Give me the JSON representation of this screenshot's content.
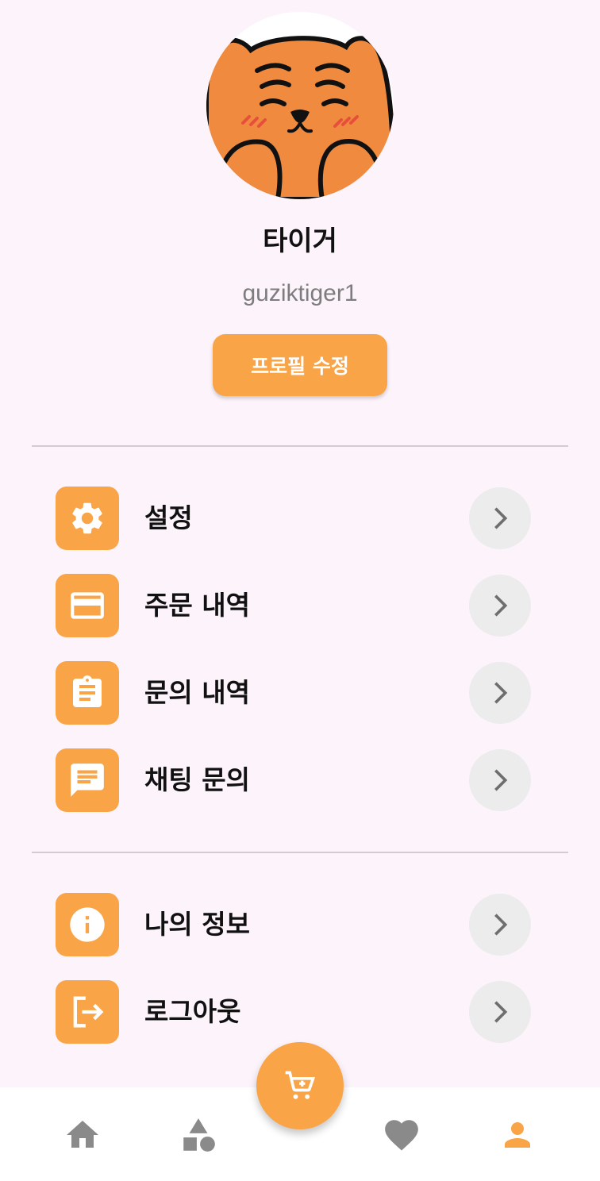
{
  "profile": {
    "avatar_icon": "tiger-avatar",
    "name": "타이거",
    "username": "guziktiger1",
    "edit_button_label": "프로필 수정"
  },
  "menu_group_1": [
    {
      "label": "설정",
      "icon": "gear-icon"
    },
    {
      "label": "주문 내역",
      "icon": "credit-card-icon"
    },
    {
      "label": "문의 내역",
      "icon": "clipboard-icon"
    },
    {
      "label": "채팅 문의",
      "icon": "chat-icon"
    }
  ],
  "menu_group_2": [
    {
      "label": "나의 정보",
      "icon": "info-icon"
    },
    {
      "label": "로그아웃",
      "icon": "logout-icon"
    }
  ],
  "bottom_nav": {
    "items": [
      "home-icon",
      "category-shapes-icon",
      "cart-icon",
      "heart-icon",
      "person-icon"
    ],
    "active": "person-icon"
  },
  "colors": {
    "accent": "#f9a446",
    "background": "#fcf3fb",
    "chevron_bg": "#ececec",
    "nav_inactive": "#8a8a8a"
  }
}
